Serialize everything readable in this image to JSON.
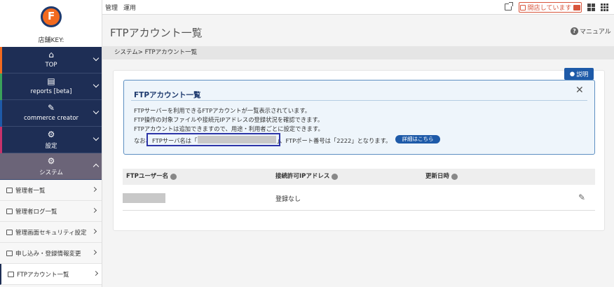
{
  "topbar": {
    "menu": [
      "管理",
      "運用"
    ],
    "open_status": "開店しています"
  },
  "sidebar": {
    "store_key_label": "店舗KEY:",
    "main": [
      {
        "label": "TOP",
        "icon": "home-icon",
        "stripe": "#f26a1f"
      },
      {
        "label": "reports [beta]",
        "icon": "chart-icon",
        "stripe": "#3aa15a"
      },
      {
        "label": "commerce creator",
        "icon": "wrench-icon",
        "stripe": "#1e5aa8"
      },
      {
        "label": "設定",
        "icon": "gear-icon",
        "stripe": "#c8326b"
      },
      {
        "label": "システム",
        "icon": "gear-icon",
        "stripe": "#6b6478"
      }
    ],
    "sub": [
      "管理者一覧",
      "管理者ログ一覧",
      "管理画面セキュリティ設定",
      "申し込み・登録情報変更",
      "FTPアカウント一覧"
    ]
  },
  "header": {
    "title": "FTPアカウント一覧",
    "manual": "マニュアル"
  },
  "breadcrumb": "システム> FTPアカウント一覧",
  "explain_btn": "説明",
  "info": {
    "title": "FTPアカウント一覧",
    "line1": "FTPサーバーを利用できるFTPアカウントが一覧表示されています。",
    "line2": "FTP操作の対象ファイルや接続元IPアドレスの登録状況を確認できます。",
    "line3": "FTPアカウントは追加できますので、用途・利用者ごとに設定できます。",
    "line4_a": "なお、",
    "line4_b": "FTPサーバ名は「",
    "line4_c": "」、FTPポート番号は「2222」となります。",
    "detail": "詳細はこちら"
  },
  "table": {
    "headers": [
      "FTPユーザー名",
      "接続許可IPアドレス",
      "更新日時"
    ],
    "rows": [
      {
        "ip": "登録なし"
      }
    ]
  }
}
